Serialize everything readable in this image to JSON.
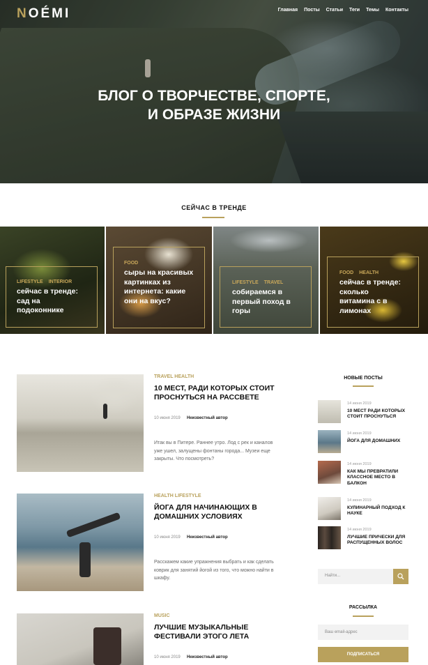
{
  "header": {
    "logo_first": "N",
    "logo_rest": "OÉMI",
    "nav": [
      "Главная",
      "Посты",
      "Статьи",
      "Теги",
      "Темы",
      "Контакты"
    ]
  },
  "hero": {
    "title_line1": "Блог о творчестве, спорте,",
    "title_line2": "и образе жизни"
  },
  "trending": {
    "title": "Сейчас в тренде",
    "cards": [
      {
        "tags": [
          "Lifestyle",
          "Interior"
        ],
        "title": "сейчас в тренде: сад на подоконнике"
      },
      {
        "tags": [
          "Food"
        ],
        "title": "сыры на красивых картинках из интернета: какие они на вкус?"
      },
      {
        "tags": [
          "Lifestyle",
          "Travel"
        ],
        "title": "собираемся в первый поход в горы"
      },
      {
        "tags": [
          "Food",
          "Health"
        ],
        "title": "сейчас в тренде: сколько витамина с в лимонах"
      }
    ]
  },
  "posts": [
    {
      "category": "Travel Health",
      "title": "10 мест, ради которых стоит проснуться на рассвете",
      "date": "10 июня 2019",
      "author": "Неизвестный автор",
      "excerpt": "Итак вы в Питере. Раннее утро. Лод с рек и каналов уже ушел, залущены фонтаны города... Музеи еще закрыты. Что посмотреть?"
    },
    {
      "category": "Health Lifestyle",
      "title": "Йога для начинающих в домашних условиях",
      "date": "10 июня 2019",
      "author": "Неизвестный автор",
      "excerpt": "Расскажем какие упражнения выбрать и как сделать коврик для занятий йогой из того, что можно найти в шкафу."
    },
    {
      "category": "Music",
      "title": "Лучшие музыкальные фестивали этого лета",
      "date": "10 июня 2019",
      "author": "Неизвестный автор",
      "excerpt": ""
    }
  ],
  "sidebar": {
    "new_posts_title": "Новые посты",
    "new_posts": [
      {
        "date": "14 июня 2019",
        "title": "10 мест ради которых стоит проснуться"
      },
      {
        "date": "14 июня 2019",
        "title": "Йога для домашних"
      },
      {
        "date": "14 июня 2019",
        "title": "Как мы превратили классное место в балкон"
      },
      {
        "date": "14 июня 2019",
        "title": "Кулинарный подход к науке"
      },
      {
        "date": "14 июня 2019",
        "title": "Лучшие прически для распущенных волос"
      }
    ],
    "search_placeholder": "Найти...",
    "newsletter_title": "Рассылка",
    "email_placeholder": "Ваш email-адрес",
    "subscribe_label": "Подписаться"
  },
  "colors": {
    "accent": "#b9a15c"
  }
}
